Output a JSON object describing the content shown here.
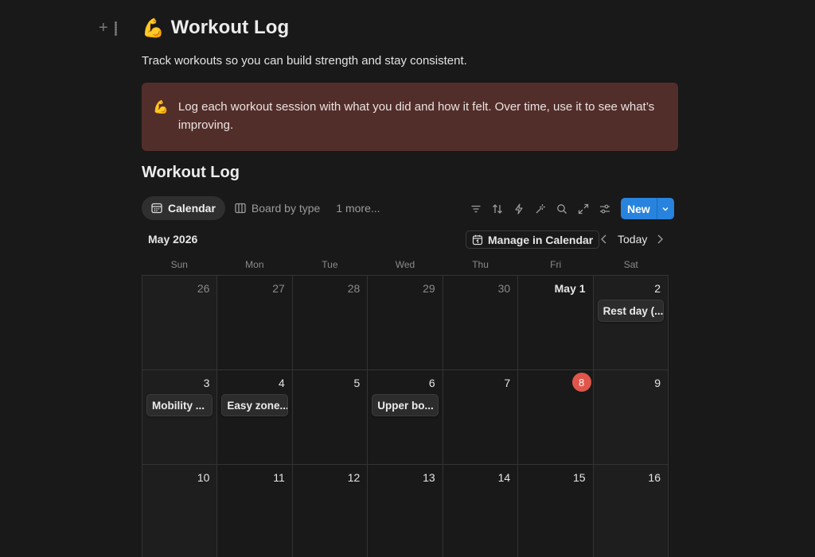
{
  "page": {
    "title_emoji": "💪",
    "title": "Workout Log",
    "subtitle": "Track workouts so you can build strength and stay consistent.",
    "callout": {
      "emoji": "💪",
      "text": "Log each workout session with what you did and how it felt. Over time, use it to see what’s improving."
    }
  },
  "database": {
    "title": "Workout Log",
    "views": [
      {
        "label": "Calendar",
        "icon": "calendar-icon",
        "active": true
      },
      {
        "label": "Board by type",
        "icon": "board-icon",
        "active": false
      }
    ],
    "more_views": "1 more...",
    "toolbar": {
      "filter": "filter-icon",
      "sort": "sort-icon",
      "automation": "lightning-icon",
      "ai": "sparkle-icon",
      "search": "search-icon",
      "expand": "expand-icon",
      "settings": "settings-sliders-icon",
      "new_label": "New"
    }
  },
  "calendar": {
    "month": "May 2026",
    "manage_label": "Manage in Calendar",
    "today_label": "Today",
    "weekdays": [
      "Sun",
      "Mon",
      "Tue",
      "Wed",
      "Thu",
      "Fri",
      "Sat"
    ],
    "weeks": [
      [
        {
          "day": "26",
          "muted": true
        },
        {
          "day": "27",
          "muted": true
        },
        {
          "day": "28",
          "muted": true
        },
        {
          "day": "29",
          "muted": true
        },
        {
          "day": "30",
          "muted": true
        },
        {
          "day": "May 1",
          "bold": true
        },
        {
          "day": "2",
          "event": "Rest day (..."
        }
      ],
      [
        {
          "day": "3",
          "event": "Mobility ..."
        },
        {
          "day": "4",
          "event": "Easy zone..."
        },
        {
          "day": "5"
        },
        {
          "day": "6",
          "event": "Upper bo..."
        },
        {
          "day": "7"
        },
        {
          "day": "8",
          "today": true
        },
        {
          "day": "9"
        }
      ],
      [
        {
          "day": "10"
        },
        {
          "day": "11"
        },
        {
          "day": "12"
        },
        {
          "day": "13"
        },
        {
          "day": "14"
        },
        {
          "day": "15"
        },
        {
          "day": "16"
        }
      ]
    ],
    "colors": {
      "today_badge": "#e0564b",
      "new_button": "#2783de",
      "callout_bg": "#522e2a"
    }
  }
}
